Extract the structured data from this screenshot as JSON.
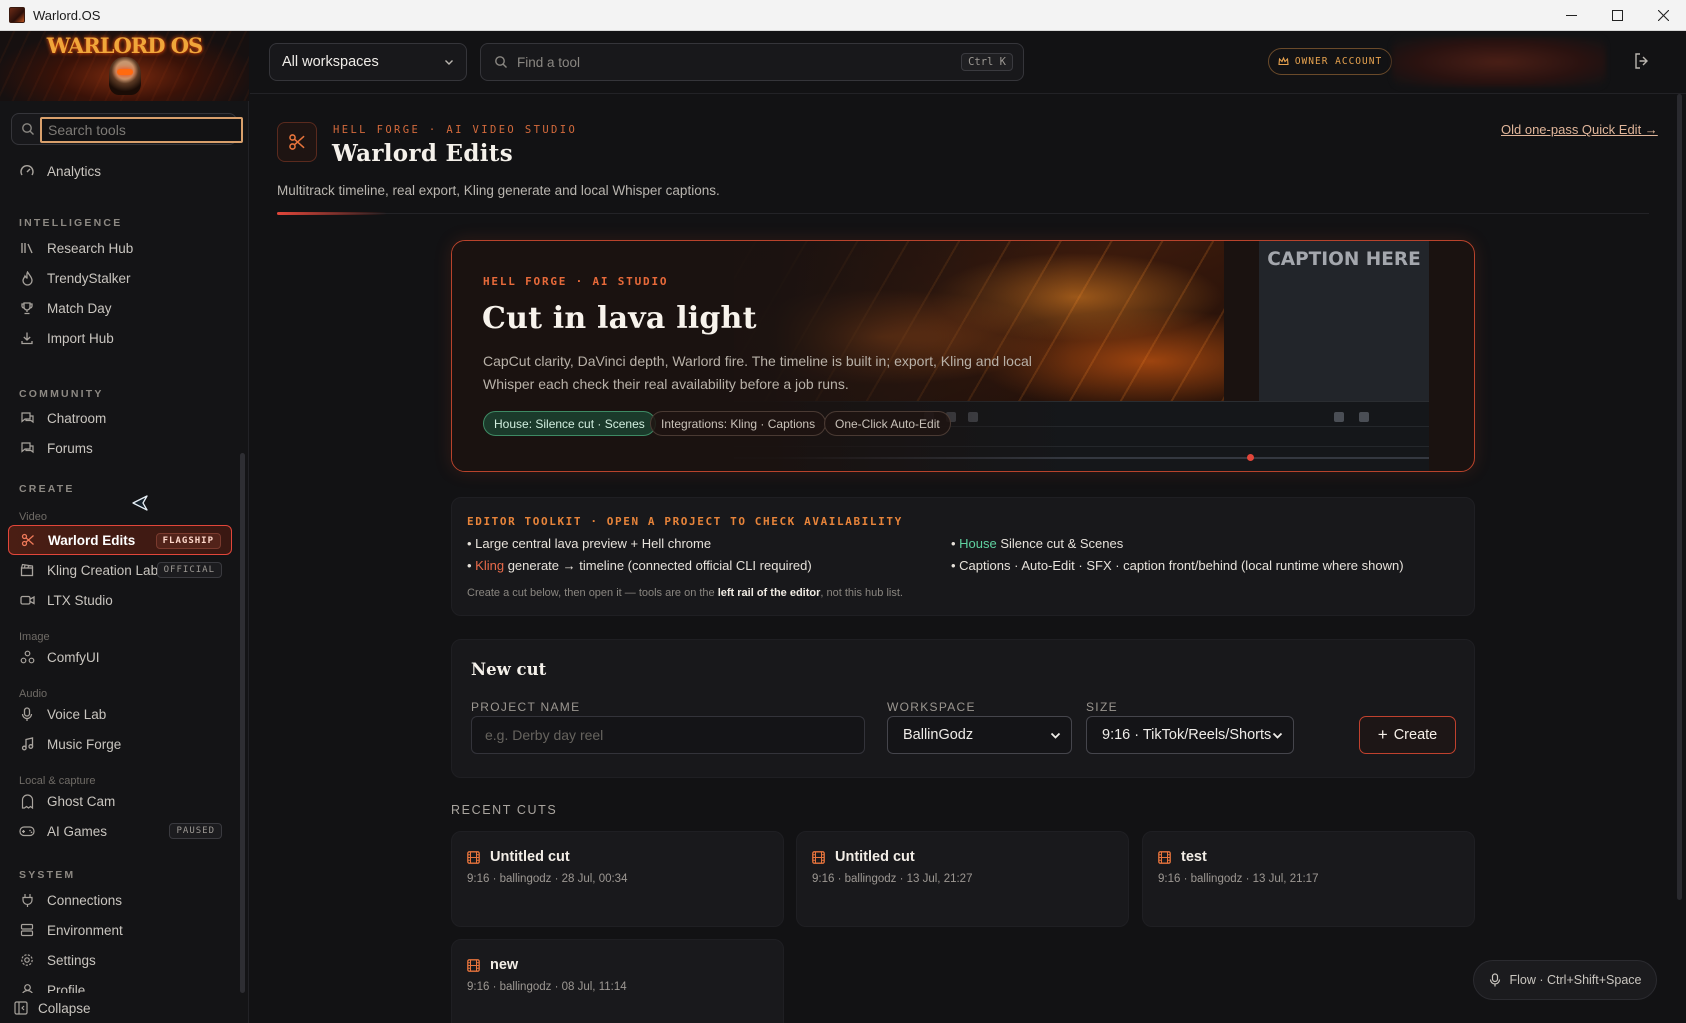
{
  "window": {
    "title": "Warlord.OS",
    "controls": [
      "minimize",
      "maximize",
      "close"
    ]
  },
  "sidebar": {
    "logo_text": "WARLORD OS",
    "search_placeholder": "Search tools",
    "items_top": [
      {
        "label": "Analytics",
        "icon": "analytics-icon"
      }
    ],
    "sections": {
      "intelligence": "INTELLIGENCE",
      "community": "COMMUNITY",
      "create": "CREATE",
      "system": "SYSTEM"
    },
    "intelligence_items": [
      {
        "label": "Research Hub",
        "icon": "library-icon"
      },
      {
        "label": "TrendyStalker",
        "icon": "flame-icon"
      },
      {
        "label": "Match Day",
        "icon": "trophy-icon"
      },
      {
        "label": "Import Hub",
        "icon": "download-icon"
      }
    ],
    "community_items": [
      {
        "label": "Chatroom",
        "icon": "chat-icon"
      },
      {
        "label": "Forums",
        "icon": "forum-icon"
      }
    ],
    "subsections": {
      "video": "Video",
      "image": "Image",
      "audio": "Audio",
      "local": "Local & capture"
    },
    "video_items": [
      {
        "label": "Warlord Edits",
        "badge": "FLAGSHIP",
        "icon": "scissors-icon",
        "active": true
      },
      {
        "label": "Kling Creation Lab",
        "badge": "OFFICIAL",
        "icon": "clapperboard-icon"
      },
      {
        "label": "LTX Studio",
        "icon": "video-camera-icon"
      }
    ],
    "image_items": [
      {
        "label": "ComfyUI",
        "icon": "nodes-icon"
      }
    ],
    "audio_items": [
      {
        "label": "Voice Lab",
        "icon": "microphone-icon"
      },
      {
        "label": "Music Forge",
        "icon": "music-icon"
      }
    ],
    "local_items": [
      {
        "label": "Ghost Cam",
        "icon": "ghost-icon"
      },
      {
        "label": "AI Games",
        "badge": "PAUSED",
        "icon": "gamepad-icon"
      }
    ],
    "system_items": [
      {
        "label": "Connections",
        "icon": "plug-icon"
      },
      {
        "label": "Environment",
        "icon": "server-icon"
      },
      {
        "label": "Settings",
        "icon": "gear-icon"
      },
      {
        "label": "Profile",
        "icon": "user-icon"
      }
    ],
    "collapse_label": "Collapse"
  },
  "topbar": {
    "workspace_select": "All workspaces",
    "tool_search_placeholder": "Find a tool",
    "shortcut": "Ctrl K",
    "owner_label": "OWNER ACCOUNT"
  },
  "header": {
    "kicker": "HELL FORGE · AI VIDEO STUDIO",
    "title": "Warlord Edits",
    "subtitle": "Multitrack timeline, real export, Kling generate and local Whisper captions.",
    "quick_edit_link": "Old one-pass Quick Edit →"
  },
  "hero": {
    "kicker": "HELL FORGE · AI STUDIO",
    "title": "Cut in lava light",
    "description": "CapCut clarity, DaVinci depth, Warlord fire. The timeline is built in; export, Kling and local Whisper each check their real availability before a job runs.",
    "caption_preview": "CAPTION HERE",
    "chips": [
      "House: Silence cut · Scenes",
      "Integrations: Kling · Captions",
      "One-Click Auto-Edit"
    ]
  },
  "toolkit": {
    "title": "EDITOR TOOLKIT · OPEN A PROJECT TO CHECK AVAILABILITY",
    "items": [
      {
        "prefix": "",
        "text": "Large central lava preview + Hell chrome"
      },
      {
        "prefix": "House",
        "text": " Silence cut & Scenes"
      },
      {
        "prefix": "Kling",
        "text": " generate → timeline (connected official CLI required)"
      },
      {
        "prefix": "",
        "text": "Captions · Auto-Edit · SFX · caption front/behind (local runtime where shown)"
      }
    ],
    "footer_before": "Create a cut below, then open it — tools are on the ",
    "footer_bold": "left rail of the editor",
    "footer_after": ", not this hub list."
  },
  "new_cut": {
    "title": "New cut",
    "project_label": "PROJECT NAME",
    "project_placeholder": "e.g. Derby day reel",
    "workspace_label": "WORKSPACE",
    "workspace_value": "BallinGodz",
    "size_label": "SIZE",
    "size_value": "9:16 · TikTok/Reels/Shorts",
    "create_label": "Create"
  },
  "recent": {
    "title": "RECENT CUTS",
    "cuts": [
      {
        "name": "Untitled cut",
        "meta": "9:16 · ballingodz · 28 Jul, 00:34"
      },
      {
        "name": "Untitled cut",
        "meta": "9:16 · ballingodz · 13 Jul, 21:27"
      },
      {
        "name": "test",
        "meta": "9:16 · ballingodz · 13 Jul, 21:17"
      },
      {
        "name": "new",
        "meta": "9:16 · ballingodz · 08 Jul, 11:14"
      }
    ]
  },
  "flow": {
    "label": "Flow · Ctrl+Shift+Space"
  },
  "colors": {
    "accent": "#e2463a",
    "orange": "#e86a3a",
    "house_green": "#5fd1a0",
    "bg": "#121214",
    "card": "#18181b"
  }
}
